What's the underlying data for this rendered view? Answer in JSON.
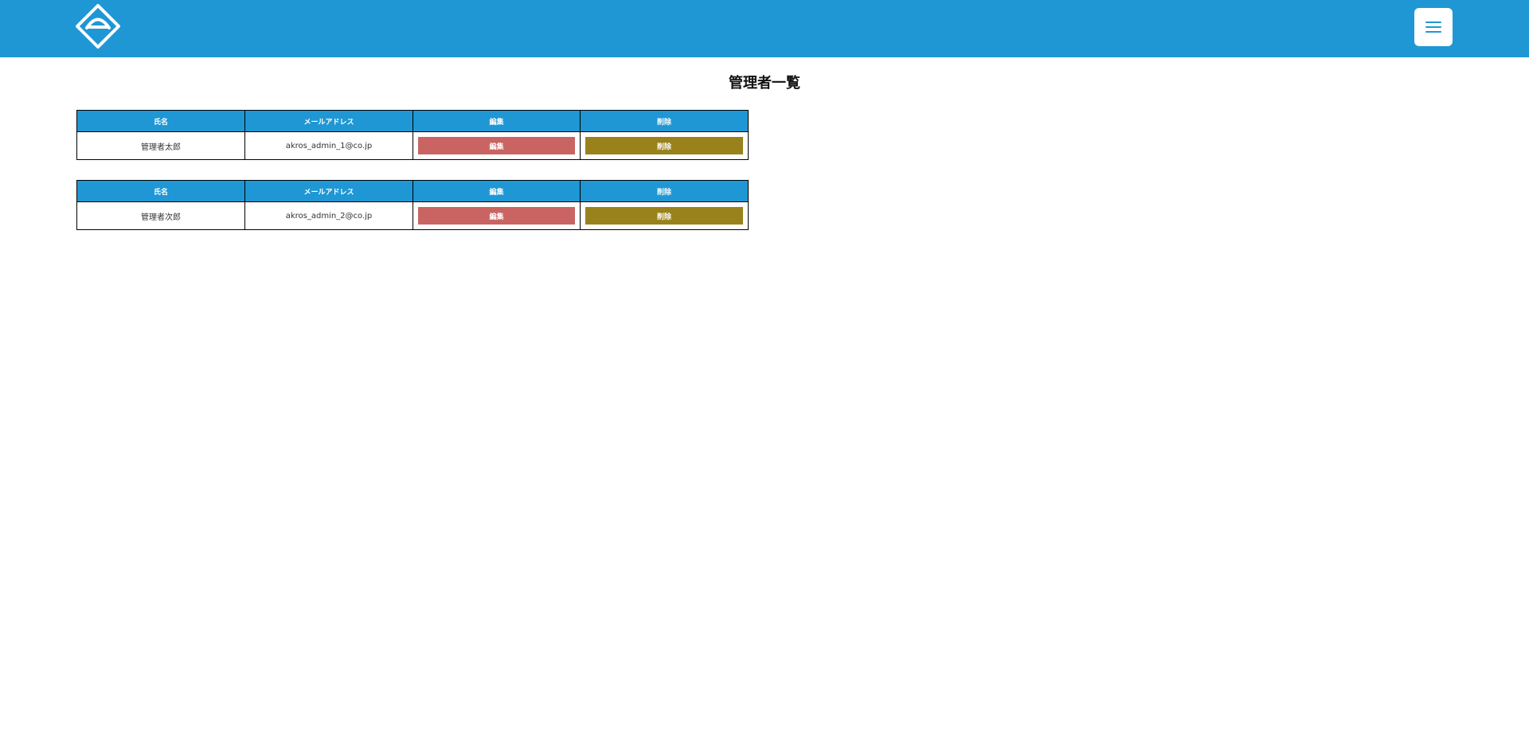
{
  "header": {
    "logo_icon": "diamond-logo-icon",
    "menu_icon": "hamburger-menu-icon",
    "background_color": "#1f97d4"
  },
  "page": {
    "title": "管理者一覧"
  },
  "tables": [
    {
      "headers": {
        "name": "氏名",
        "email": "メールアドレス",
        "edit": "編集",
        "delete": "削除"
      },
      "row": {
        "name": "管理者太郎",
        "email": "akros_admin_1@co.jp",
        "edit_label": "編集",
        "delete_label": "削除"
      }
    },
    {
      "headers": {
        "name": "氏名",
        "email": "メールアドレス",
        "edit": "編集",
        "delete": "削除"
      },
      "row": {
        "name": "管理者次郎",
        "email": "akros_admin_2@co.jp",
        "edit_label": "編集",
        "delete_label": "削除"
      }
    }
  ],
  "colors": {
    "edit_button": "#c96463",
    "delete_button": "#99821b",
    "table_header": "#1f97d4"
  }
}
